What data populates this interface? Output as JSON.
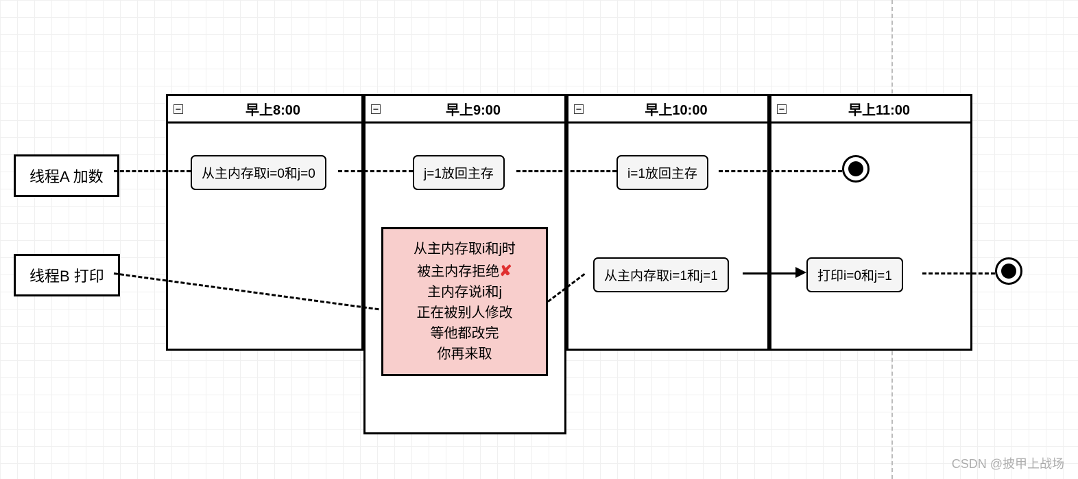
{
  "threads": {
    "a": "线程A 加数",
    "b": "线程B 打印"
  },
  "columns": {
    "c1": "早上8:00",
    "c2": "早上9:00",
    "c3": "早上10:00",
    "c4": "早上11:00"
  },
  "nodes": {
    "a1": "从主内存取i=0和j=0",
    "a2": "j=1放回主存",
    "a3": "i=1放回主存",
    "b3": "从主内存取i=1和j=1",
    "b4": "打印i=0和j=1"
  },
  "note": {
    "l1": "从主内存取i和j时",
    "l2a": "被主内存拒绝",
    "l2x": "✘",
    "l3": "主内存说i和j",
    "l4": "正在被别人修改",
    "l5": "等他都改完",
    "l6": "你再来取"
  },
  "watermark": "CSDN @披甲上战场"
}
